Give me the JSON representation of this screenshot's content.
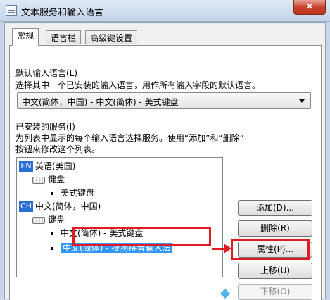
{
  "window": {
    "title": "文本服务和输入语言",
    "close_glyph": "✕"
  },
  "tabs": [
    {
      "label": "常规",
      "active": true
    },
    {
      "label": "语言栏",
      "active": false
    },
    {
      "label": "高级键设置",
      "active": false
    }
  ],
  "default_lang": {
    "title": "默认输入语言(L)",
    "description": "选择其中一个已安装的输入语言，用作所有输入字段的默认语言。",
    "selected": "中文(简体，中国) - 中文(简体) - 美式键盘"
  },
  "services": {
    "title": "已安装的服务(I)",
    "description_line1": "为列表中显示的每个输入语言选择服务。使用“添加”和“删除”",
    "description_line2": "按钮来修改这个列表。",
    "tree": {
      "en_badge": "EN",
      "en_label": "英语(美国)",
      "en_keyboard": "键盘",
      "en_kb1": "美式键盘",
      "ch_badge": "CH",
      "ch_label": "中文(简体，中国)",
      "ch_keyboard": "键盘",
      "ch_kb1": "中文(简体) - 美式键盘",
      "ch_kb2": "中文(简体) - 搜狗拼音输入法"
    }
  },
  "buttons": {
    "add": "添加(D)...",
    "remove": "删除(R)",
    "properties": "属性(P)...",
    "move_up": "上移(U)",
    "move_down": "下移(O)"
  },
  "colors": {
    "highlight": "#e01b24",
    "selection": "#3297fd",
    "lang_badge": "#2b6ed4"
  }
}
